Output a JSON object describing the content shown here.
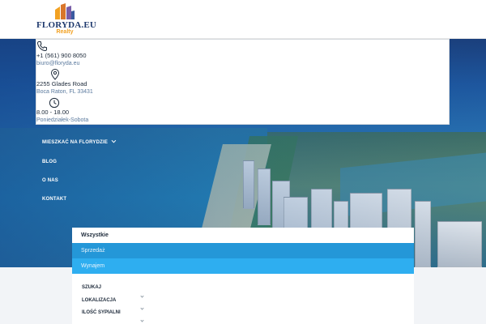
{
  "header": {
    "logo_name": "FLORYDA.EU",
    "logo_sub": "Realty"
  },
  "contact": {
    "phone": "+1 (561) 900 8050",
    "email": "biuro@floryda.eu",
    "address_line1": "2255 Glades Road",
    "address_line2": "Boca Raton, FL 33431",
    "hours": "8.00 - 18.00",
    "days": "Poniedziałek-Sobota"
  },
  "nav": {
    "items": [
      {
        "label": "MIESZKAĆ NA FLORYDZIE",
        "has_dropdown": true
      },
      {
        "label": "BLOG",
        "has_dropdown": false
      },
      {
        "label": "O NAS",
        "has_dropdown": false
      },
      {
        "label": "KONTAKT",
        "has_dropdown": false
      }
    ]
  },
  "search": {
    "tabs": [
      "Wszystkie",
      "Sprzedaż",
      "Wynajem"
    ],
    "active_tab": "Wszystkie",
    "fields": [
      "SZUKAJ",
      "LOKALIZACJA",
      "ILOŚĆ SYPIALNI"
    ]
  },
  "colors": {
    "brand_navy": "#1f3a6e",
    "brand_orange": "#f2a122",
    "accent_blue": "#2497d8",
    "accent_light_blue": "#2eaef0"
  },
  "icons": [
    "phone-icon",
    "map-pin-icon",
    "clock-icon",
    "chevron-down-icon"
  ]
}
